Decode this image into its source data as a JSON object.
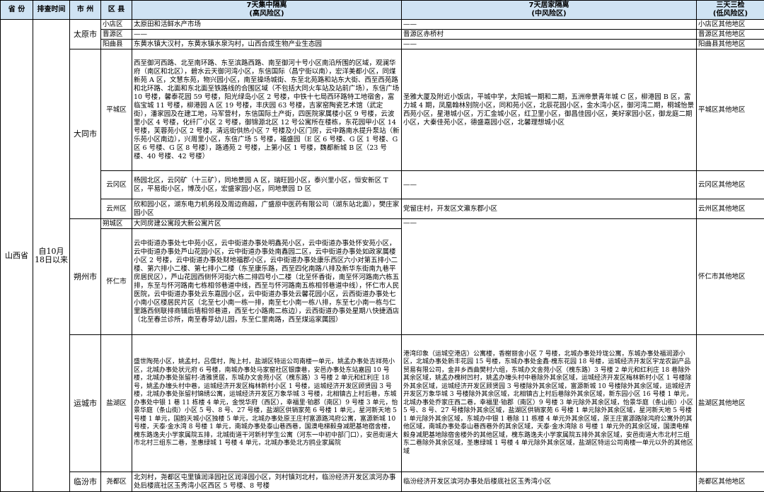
{
  "headers": {
    "province": "省 份",
    "time": "排查时间",
    "city": "市 州",
    "county": "区 县",
    "high_line1": "7天集中隔离",
    "high_line2": "(高风险区)",
    "mid_line1": "7天居家隔离",
    "mid_line2": "(中风险区)",
    "low_line1": "三天三检",
    "low_line2": "(低风险区)"
  },
  "province": "山西省",
  "time": "自10月18日以来",
  "cities": {
    "taiyuan": "太原市",
    "datong": "大同市",
    "shuozhou": "朔州市",
    "yuncheng": "运城市",
    "linfen": "临汾市"
  },
  "rows": [
    {
      "county": "小店区",
      "high": "太原田和活鲜水产市场",
      "mid": "——",
      "low": "小店区其他地区"
    },
    {
      "county": "晋源区",
      "high": "——",
      "mid": "晋源区赤桥村",
      "low": "晋源区其他地区"
    },
    {
      "county": "阳曲县",
      "high": "东黄水镇大汉村，东黄水镇水泉沟村，山西合成生物产业生态园",
      "mid": "——",
      "low": "阳曲县其他地区"
    },
    {
      "county": "平城区",
      "high": "西至御河西路、北至南环路、东至滨路西路、南至御河十号小区南沿所围的区域，观澜华府（南区和北区），碧水云天御河湾小区，东信国际（昌宁街以南），宏洋美都小区，同煤新苑 A 区，文慧东苑，物兴园小区，南至操场城街、东至北苑路和站东大街、西至西苑路和北环路、北面和东北面至铁路线的合围区域（不包括大同火车站及站前广场），东信广场 10 号楼，馨泰花园 59 号楼，阳光绿岛小区 2 号楼，中铁十七局西环路特工地宿舍，富临宝城 11 号楼，柳港园 A 区 19 号楼，丰庆园 63 号楼，吉家窑陶瓷艺术馆（武定街），潘家园及在建工地，马军营村，东信国际土产街，四医院家属楼小区 9 号楼，云波里小区 4 号楼，化纤厂小区 2 号楼，御锦源北区 12 号公寓所在楼栋，东花园甲小区 14 号楼，芙蓉苑小区 2 号楼，清远街供热小区 7 号楼及小区门房，云中路南水提升泵站（新乐苑小区南边），兴周里小区，东信广场 5 号楼，福盛园（E 区 6 号楼、G 区 1 号楼、G 区 6 号楼、G 区 8 号楼），路通苑 2 号楼，上第小区 1 号楼，魏都新城 B 区（23 号楼、40 号楼、42 号楼）",
      "mid": "圣雅大厦及附近小饭店，平城中学，太阳城一期和二期，五洲帝景青年城 C 区，柳港园 B 区，富力城 4 期，凤凰翰林别院小区，同和苑小区，北辰花园小区，金水湾小区，御河湾二期，桐城怡景西苑小区，星港城小区，万汇金城小区，红卫里小区，御昌佳园小区，美好家园小区，御龙庭二期小区，大秦佳苑小区，德盛嘉园小区，北馨理想城小区",
      "low": "平城区其他地区"
    },
    {
      "county": "云冈区",
      "high": "杨园北区，云冈矿（十三矿），同地景园 A 区，瑞旺园小区，泰兴里小区，恒安新区 T 区，平易街小区，博茂小区，宏盛家园小区，同地景园 D 区",
      "mid": "——",
      "low": "云冈区其他地区"
    },
    {
      "county": "云州区",
      "high": "欣和园小区，湖东电力机务段及周边商超，广盛原中医药有限公司（湖东站北面），樊庄家园小区",
      "mid": "党留庄村，开发区文瀛东郡小区",
      "low": "云州区其他地区"
    },
    {
      "county": "朔城区",
      "high": "大同房建公寓段大新公寓片区",
      "mid": "",
      "low": ""
    },
    {
      "county": "怀仁市",
      "high": "云中街道办事处七中苑小区，云中街道办事处明鑫苑小区，云中街道办事处怀安苑小区，云中街道办事处芦山花园小区，云中街道办事处南鑫园二区，云中街道办事处如政家属楼小区 2 号楼，云中街道办事处财地福郡小区，云中街道办事处康乐西区六小对第五排小二楼、第六排小二楼、第七排小二楼（东至康乐路，西至四化南路八排及新华东街南九巷平房居民区），芦山花园西侧怀河街六栋二排四号小二楼（北至怀香街，南至怀河路南六栋五排，东至与怀河路南七栋相邻巷道中线，西至与怀河路南五栋相邻巷道中线），怀仁市人民医院，云中街道办事处云东嘉园小区，云中街道办事处云馨花园小区，云西街道办事处七小南小区楼居民片区（北至七小南一栋一排，南至七小南一栋八排，东至七小南一栋与仁里路西侧联排商铺后墙相邻巷道，西至七小路南二栋边），云西街道办事处星期八快捷酒店（北至春兰诊所，南至春芽幼儿园，东至仁里南路，西至煤运家属园）",
      "mid": "——",
      "low": "怀仁市其他地区"
    },
    {
      "county": "盐湖区",
      "high": "盛世陶苑小区，姚孟村，吕儒村，陶上村，盐湖区特运公司南楼一单元，姚孟办事处吉祥苑小区，北城办事处状元府 6 号楼，南城办事处马家窑社区银康巷，安邑办事处东站嘉园 10 号楼，北城办事处张留村-清雅贤居，东城办文舍苑小区（槐东路）3 号楼 2 单元和红利庄 18 号，姚孟办壕头村中巷，运城经济开发区梅林新村小区 1 号楼，运城经济开发区顾贤园 3 号楼，北城办事处张留村锦绣公寓，运城经济开发区万象华城 3 号楼，北相镇古上村后巷，东城办事处中银 1 巷 11 栋楼 4 单元，金悦华府（西区），幸福里·铂郡（南区）9 号楼 3 单元，怡景华庭（条山街）小区 5 号、8 号、27 号楼，盐湖区供销家苑 6 号楼 1 单元，星河新天地 5 号楼 1 单元，国韵天城小区独楼 5 单元，北城办事处原王庄村富源路鸿府公寓，富源新城 10 号楼，天泰·金水湾 8 号楼 1 单元，南城办事处泰山巷西巷，国澳电梯毅身减肥基地宿舍楼，槐东路逸夫小学家属院五排，北城街道干河新村学生公寓（河东一中初中部门口），安邑街道大市北村三组东二巷，圣惠绿城 1 号楼 4 单元，北城办事处北方鸥业家属院",
      "mid": "港湾印象（运城空港店）公寓楼，香榭丽舍小区 7 号楼，北城办事处玲珑公寓，东城办事处福润源小区，北城办事处新丰花园 15 号楼，东城办事处金鑫·槐东花园 18 号楼，运城经济开发区宇龙农副产品贸易有限公司，金井乡西曲樊村六组，东城办文舍苑小区（槐东路）3 号楼 2 单元和红利庄 18 巷除外其余区域，姚孟办槐树凹村，姚孟办壕头村中巷除外其余区域，运城经济开发区梅林新村小区 1 号楼除外其余区域，运城经济开发区顾贤园 3 号楼除外其余区域，富源新城 10 号楼除外其余区域，运城经济开发区万象华城 3 号楼除外其余区域，北相镇古上村后巷除外其余区域，新东园小区 16 号楼 1 单元，北城办事处乔家庄西二巷，幸福里·铂郡（南区）9 号楼 3 单元除外其余区域，怡景华庭（条山街）小区 5 号、8 号、27 号楼除外其余区域，盐湖区供销家苑 6 号楼 1 单元除外其余区域，星河新天地 5 号楼 1 单元除外其余区域，东城办中银 1 巷除 11 栋楼 4 单元外其余区域，原王庄富源路除鸿府公寓外的其他区域，南城办事处泰山巷西巷外的其余区域，天泰·金水湾除 8 号楼 1 单元外的其余区域，国澳电梯毅身减肥基地除宿舍楼外的其他区域，槐东路逸夫小学家属院五排外其余区域，安邑街道大市北村三组东二巷除外其余区域，圣惠绿城 1 号楼 4 单元除外其余区域，盐湖区特运公司南楼一单元以外的其他区域",
      "low": "盐湖区其他地区"
    },
    {
      "county": "尧都区",
      "high": "北刘村，尧都区屯里镇润泽园社区润泽园小区，刘村镇刘北村，临汾经济开发区滨河办事处后楼底社区玉秀湾小区西区 5 号楼、8 号楼",
      "mid": "临汾经济开发区滨河办事处后楼底社区玉秀湾小区",
      "low": "尧都区其他地区"
    }
  ]
}
